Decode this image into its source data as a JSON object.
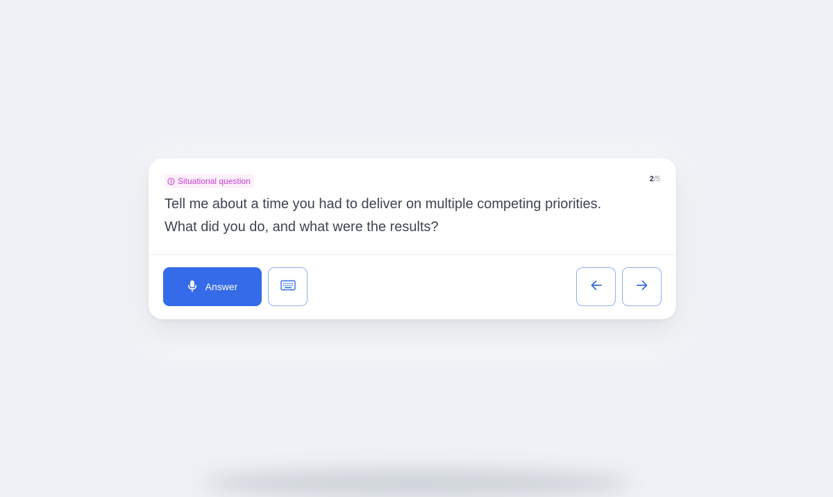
{
  "question_card": {
    "tag_icon": "info-icon",
    "tag_label": "Situational question",
    "tag_color": "#c53bd0",
    "counter": {
      "current": "2",
      "separator": "/",
      "total": "5"
    },
    "question_line_1": "Tell me about a time you had to deliver on multiple competing priorities.",
    "question_line_2": "What did you do, and what were the results?"
  },
  "actions": {
    "answer_label": "Answer",
    "answer_icon": "microphone-icon",
    "keyboard_icon": "keyboard-icon",
    "prev_icon": "arrow-left-icon",
    "next_icon": "arrow-right-icon",
    "accent_color": "#356be8"
  }
}
